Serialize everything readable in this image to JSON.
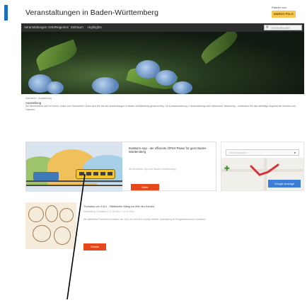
{
  "header": {
    "site_title": "Veranstaltungen in Baden-Württemberg",
    "partner_label": "Partner von",
    "partner_logo_text": "MARCO POLO"
  },
  "nav": {
    "items": [
      "Veranstaltungen",
      "Orte/Regionen",
      "Zeitraum",
      "Highlights"
    ],
    "search_placeholder": "Schnellsuche",
    "search_icon": "search-icon"
  },
  "breadcrumb": "Startseite › Ausstellung",
  "section": {
    "label": "Ausstellung",
    "intro": "Sie interessieren sich für Kunst, Kultur und Geschichte? Dann sind Sie bei den Ausstellungen in Baden-Württemberg genau richtig. Ob Kunstausstellung, Fotoausstellung oder historische Sammlung – entdecken Sie das vielfältige Angebot der Museen und Galerien."
  },
  "event_card": {
    "title": "BusBahn-App - der effiziente ÖPNV-Planer für ganz Baden-Württemberg",
    "meta": "der BusBahn-App von Baden-Württemberg",
    "button": "Mehr"
  },
  "ad": {
    "input_placeholder": "Abfahrt eingeben",
    "pin_icon": "location-pin-icon",
    "plus_icon": "plus-icon",
    "brand": "Google Anzeige"
  },
  "listing2": {
    "title": "\"Konstanz um 1414 - Städtischer Alltag zur Zeit des Konzils\"",
    "meta": "Ausstellung | Konstanz | 17.04.2014 - 14.10.2014",
    "description": "Die städtische Fachwerk-Konstanz um 1414 zur Zeit des Konzils erleben. Ausstellung im Rosgartenmuseum Konstanz.",
    "button": "Details"
  },
  "colors": {
    "accent": "#e7481a",
    "nav_bg": "#2d2d2d",
    "brand_blue": "#1f6fb8"
  }
}
